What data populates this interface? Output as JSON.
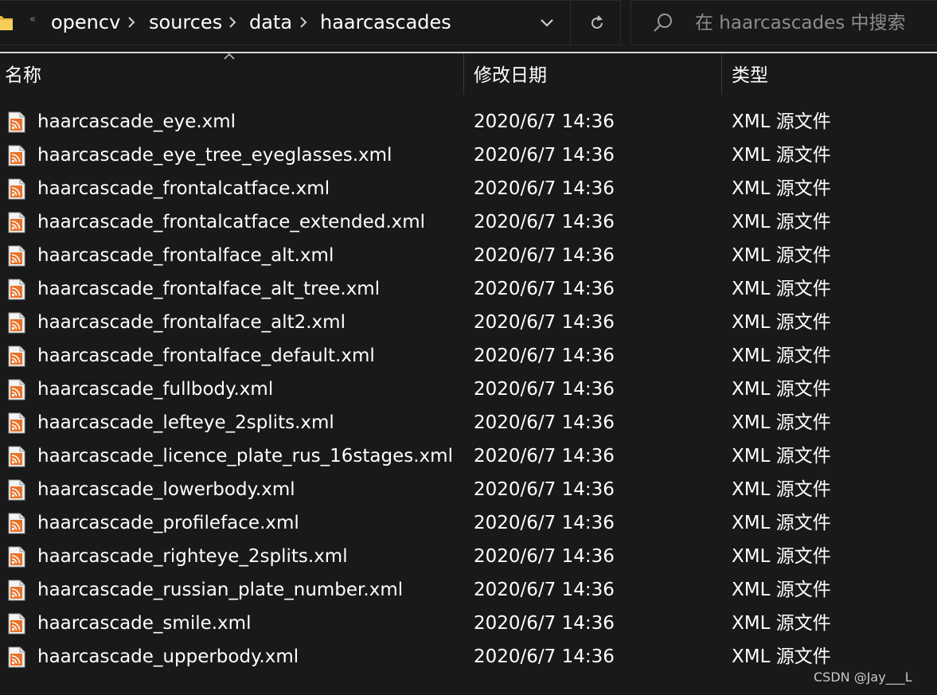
{
  "address_bar": {
    "overflow_chevron": "«",
    "breadcrumbs": [
      "opencv",
      "sources",
      "data",
      "haarcascades"
    ]
  },
  "search": {
    "placeholder": "在 haarcascades 中搜索"
  },
  "columns": {
    "name": "名称",
    "date_modified": "修改日期",
    "type": "类型"
  },
  "files": [
    {
      "name": "haarcascade_eye.xml",
      "date": "2020/6/7 14:36",
      "type": "XML 源文件"
    },
    {
      "name": "haarcascade_eye_tree_eyeglasses.xml",
      "date": "2020/6/7 14:36",
      "type": "XML 源文件"
    },
    {
      "name": "haarcascade_frontalcatface.xml",
      "date": "2020/6/7 14:36",
      "type": "XML 源文件"
    },
    {
      "name": "haarcascade_frontalcatface_extended.xml",
      "date": "2020/6/7 14:36",
      "type": "XML 源文件"
    },
    {
      "name": "haarcascade_frontalface_alt.xml",
      "date": "2020/6/7 14:36",
      "type": "XML 源文件"
    },
    {
      "name": "haarcascade_frontalface_alt_tree.xml",
      "date": "2020/6/7 14:36",
      "type": "XML 源文件"
    },
    {
      "name": "haarcascade_frontalface_alt2.xml",
      "date": "2020/6/7 14:36",
      "type": "XML 源文件"
    },
    {
      "name": "haarcascade_frontalface_default.xml",
      "date": "2020/6/7 14:36",
      "type": "XML 源文件"
    },
    {
      "name": "haarcascade_fullbody.xml",
      "date": "2020/6/7 14:36",
      "type": "XML 源文件"
    },
    {
      "name": "haarcascade_lefteye_2splits.xml",
      "date": "2020/6/7 14:36",
      "type": "XML 源文件"
    },
    {
      "name": "haarcascade_licence_plate_rus_16stages.xml",
      "date": "2020/6/7 14:36",
      "type": "XML 源文件"
    },
    {
      "name": "haarcascade_lowerbody.xml",
      "date": "2020/6/7 14:36",
      "type": "XML 源文件"
    },
    {
      "name": "haarcascade_profileface.xml",
      "date": "2020/6/7 14:36",
      "type": "XML 源文件"
    },
    {
      "name": "haarcascade_righteye_2splits.xml",
      "date": "2020/6/7 14:36",
      "type": "XML 源文件"
    },
    {
      "name": "haarcascade_russian_plate_number.xml",
      "date": "2020/6/7 14:36",
      "type": "XML 源文件"
    },
    {
      "name": "haarcascade_smile.xml",
      "date": "2020/6/7 14:36",
      "type": "XML 源文件"
    },
    {
      "name": "haarcascade_upperbody.xml",
      "date": "2020/6/7 14:36",
      "type": "XML 源文件"
    }
  ],
  "watermark": "CSDN @Jay___L",
  "colors": {
    "background": "#191919",
    "text": "#ffffff",
    "muted_text": "#8c8c8c",
    "border": "#2b2b2b",
    "folder_icon": "#e8b53c",
    "xml_file_icon_accent": "#e8732a"
  },
  "icons": {
    "folder": "folder-icon",
    "breadcrumb_separator": "chevron-right-icon",
    "address_dropdown": "chevron-down-icon",
    "refresh": "refresh-icon",
    "search": "search-icon",
    "sort": "sort-up-icon",
    "file": "xml-file-icon"
  }
}
